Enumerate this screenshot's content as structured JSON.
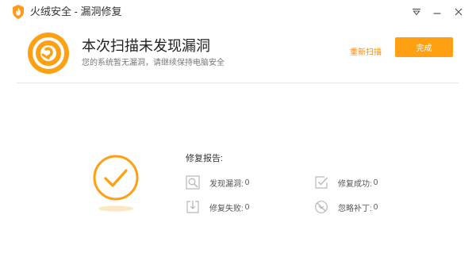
{
  "window": {
    "title": "火绒安全 - 漏洞修复",
    "icons": {
      "logo": "huorong-flame-icon",
      "menu": "dropdown-menu-icon",
      "minimize": "minimize-icon",
      "close": "close-icon"
    }
  },
  "header": {
    "title": "本次扫描未发现漏洞",
    "subtitle": "您的系统暂无漏洞，请继续保持电脑安全",
    "rescan_label": "重新扫描",
    "done_label": "完成",
    "icon": "vulnerability-shield-icon"
  },
  "report": {
    "title": "修复报告:",
    "result_icon": "check-circle-icon",
    "stats": [
      {
        "label": "发现漏洞:",
        "value": "0",
        "icon": "magnifier-icon"
      },
      {
        "label": "修复成功:",
        "value": "0",
        "icon": "checkbox-icon"
      },
      {
        "label": "修复失败:",
        "value": "0",
        "icon": "download-fail-icon"
      },
      {
        "label": "忽略补丁:",
        "value": "0",
        "icon": "ignore-icon"
      }
    ]
  },
  "colors": {
    "accent": "#ffa012",
    "accent_dark": "#ff8a00",
    "icon_gray": "#b8b8b8",
    "divider": "#e6e6e6"
  }
}
